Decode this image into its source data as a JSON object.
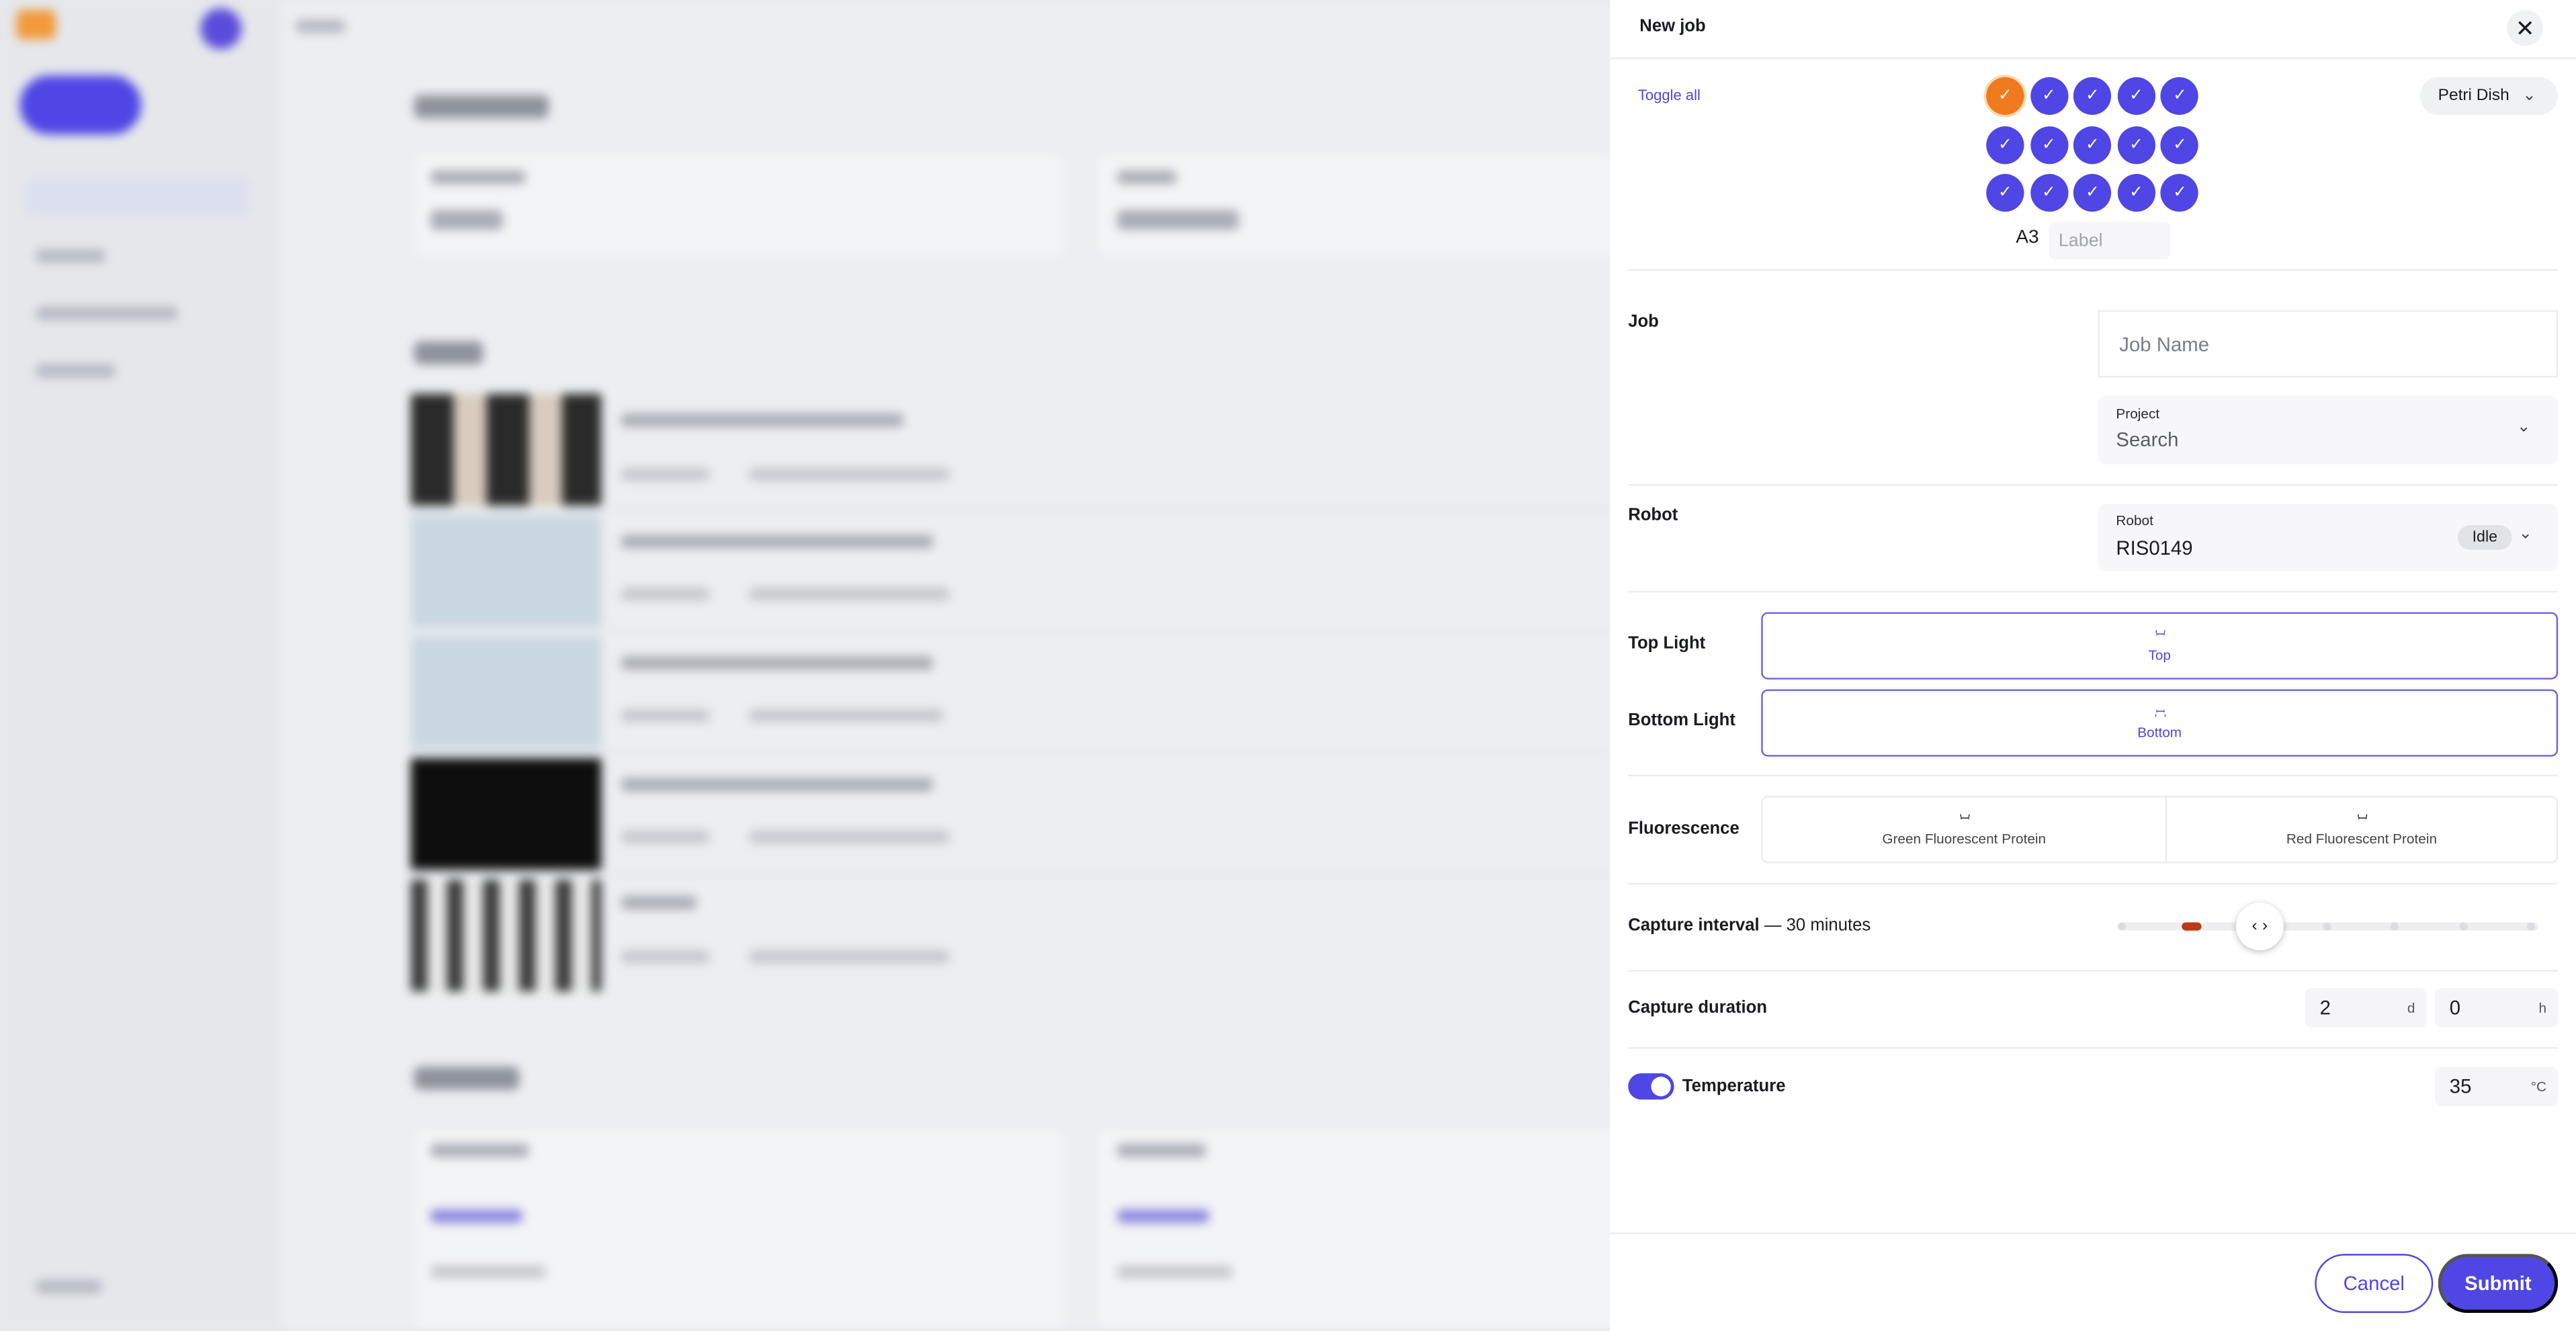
{
  "panel": {
    "title": "New job",
    "close_icon": "close-icon"
  },
  "wells": {
    "toggle_all_label": "Toggle all",
    "plate_type": "Petri Dish",
    "rows": [
      "A",
      "B",
      "C"
    ],
    "columns": 5,
    "selected_well": "A3",
    "label_placeholder": "Label",
    "check_glyph": "✓"
  },
  "job": {
    "section_label": "Job",
    "name_placeholder": "Job Name",
    "project_label": "Project",
    "project_value": "Search"
  },
  "robot": {
    "section_label": "Robot",
    "field_label": "Robot",
    "value": "RIS0149",
    "status": "Idle"
  },
  "lights": {
    "top_section_label": "Top Light",
    "top_button_label": "Top",
    "bottom_section_label": "Bottom Light",
    "bottom_button_label": "Bottom"
  },
  "fluorescence": {
    "section_label": "Fluorescence",
    "options": [
      "Green Fluorescent Protein",
      "Red Fluorescent Protein"
    ]
  },
  "capture_interval": {
    "label": "Capture interval",
    "value_text": "— 30 minutes",
    "steps": 7,
    "selected_step": 1
  },
  "capture_duration": {
    "label": "Capture duration",
    "days_value": "2",
    "days_unit": "d",
    "hours_value": "0",
    "hours_unit": "h"
  },
  "temperature": {
    "label": "Temperature",
    "enabled": true,
    "value": "35",
    "unit": "°C"
  },
  "footer": {
    "cancel_label": "Cancel",
    "submit_label": "Submit"
  },
  "colors": {
    "accent": "#4f46e5",
    "selected_well": "#f07a1e",
    "slider_selected": "#b93a16"
  }
}
